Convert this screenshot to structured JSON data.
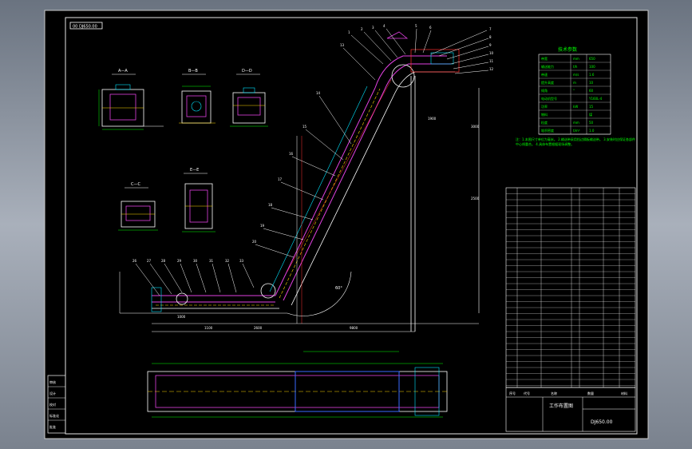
{
  "drawing": {
    "tag": "00 DJ650.00",
    "title_block": {
      "drawing_name": "工作布置图",
      "drawing_number": "DJ650.00",
      "headers": [
        "序号",
        "代号",
        "名称",
        "数量",
        "材料"
      ]
    },
    "tech_params": {
      "title": "技术参数",
      "rows": [
        {
          "name": "带宽",
          "unit": "mm",
          "value": "650"
        },
        {
          "name": "输送能力",
          "unit": "t/h",
          "value": "100"
        },
        {
          "name": "带速",
          "unit": "m/s",
          "value": "1.6"
        },
        {
          "name": "提升高度",
          "unit": "m",
          "value": "10"
        },
        {
          "name": "倾角",
          "unit": "°",
          "value": "60"
        },
        {
          "name": "电动机型号",
          "unit": "",
          "value": "Y160L-4"
        },
        {
          "name": "功率",
          "unit": "kW",
          "value": "15"
        },
        {
          "name": "物料",
          "unit": "",
          "value": "煤"
        },
        {
          "name": "粒度",
          "unit": "mm",
          "value": "50"
        },
        {
          "name": "堆积密度",
          "unit": "t/m³",
          "value": "1.0"
        }
      ]
    },
    "notes": "注：1.本图尺寸单位为毫米。 2.输送带采用挡边隔板输送带。 3.安装时应保证各部件中心线重合。 4.具体布置根据现场调整。",
    "section_labels": [
      "A—A",
      "B—B",
      "D—D",
      "C—C",
      "E—E"
    ],
    "callouts_top": [
      "1",
      "2",
      "3",
      "4",
      "5",
      "6",
      "7",
      "8",
      "9",
      "10",
      "11",
      "12",
      "13"
    ],
    "callouts_incline": [
      "14",
      "15",
      "16",
      "17",
      "18",
      "19",
      "20",
      "21",
      "22",
      "23",
      "24",
      "25"
    ],
    "callouts_bottom": [
      "26",
      "27",
      "28",
      "29",
      "30",
      "31",
      "32",
      "33"
    ],
    "dims": {
      "d1": "1100",
      "d2": "2600",
      "d3": "9800",
      "d4": "1900",
      "d5": "1000",
      "d6": "60°",
      "d7": "2500",
      "d8": "3000"
    },
    "left_block": [
      "审核",
      "设计",
      "校对",
      "标准化",
      "批准"
    ]
  }
}
